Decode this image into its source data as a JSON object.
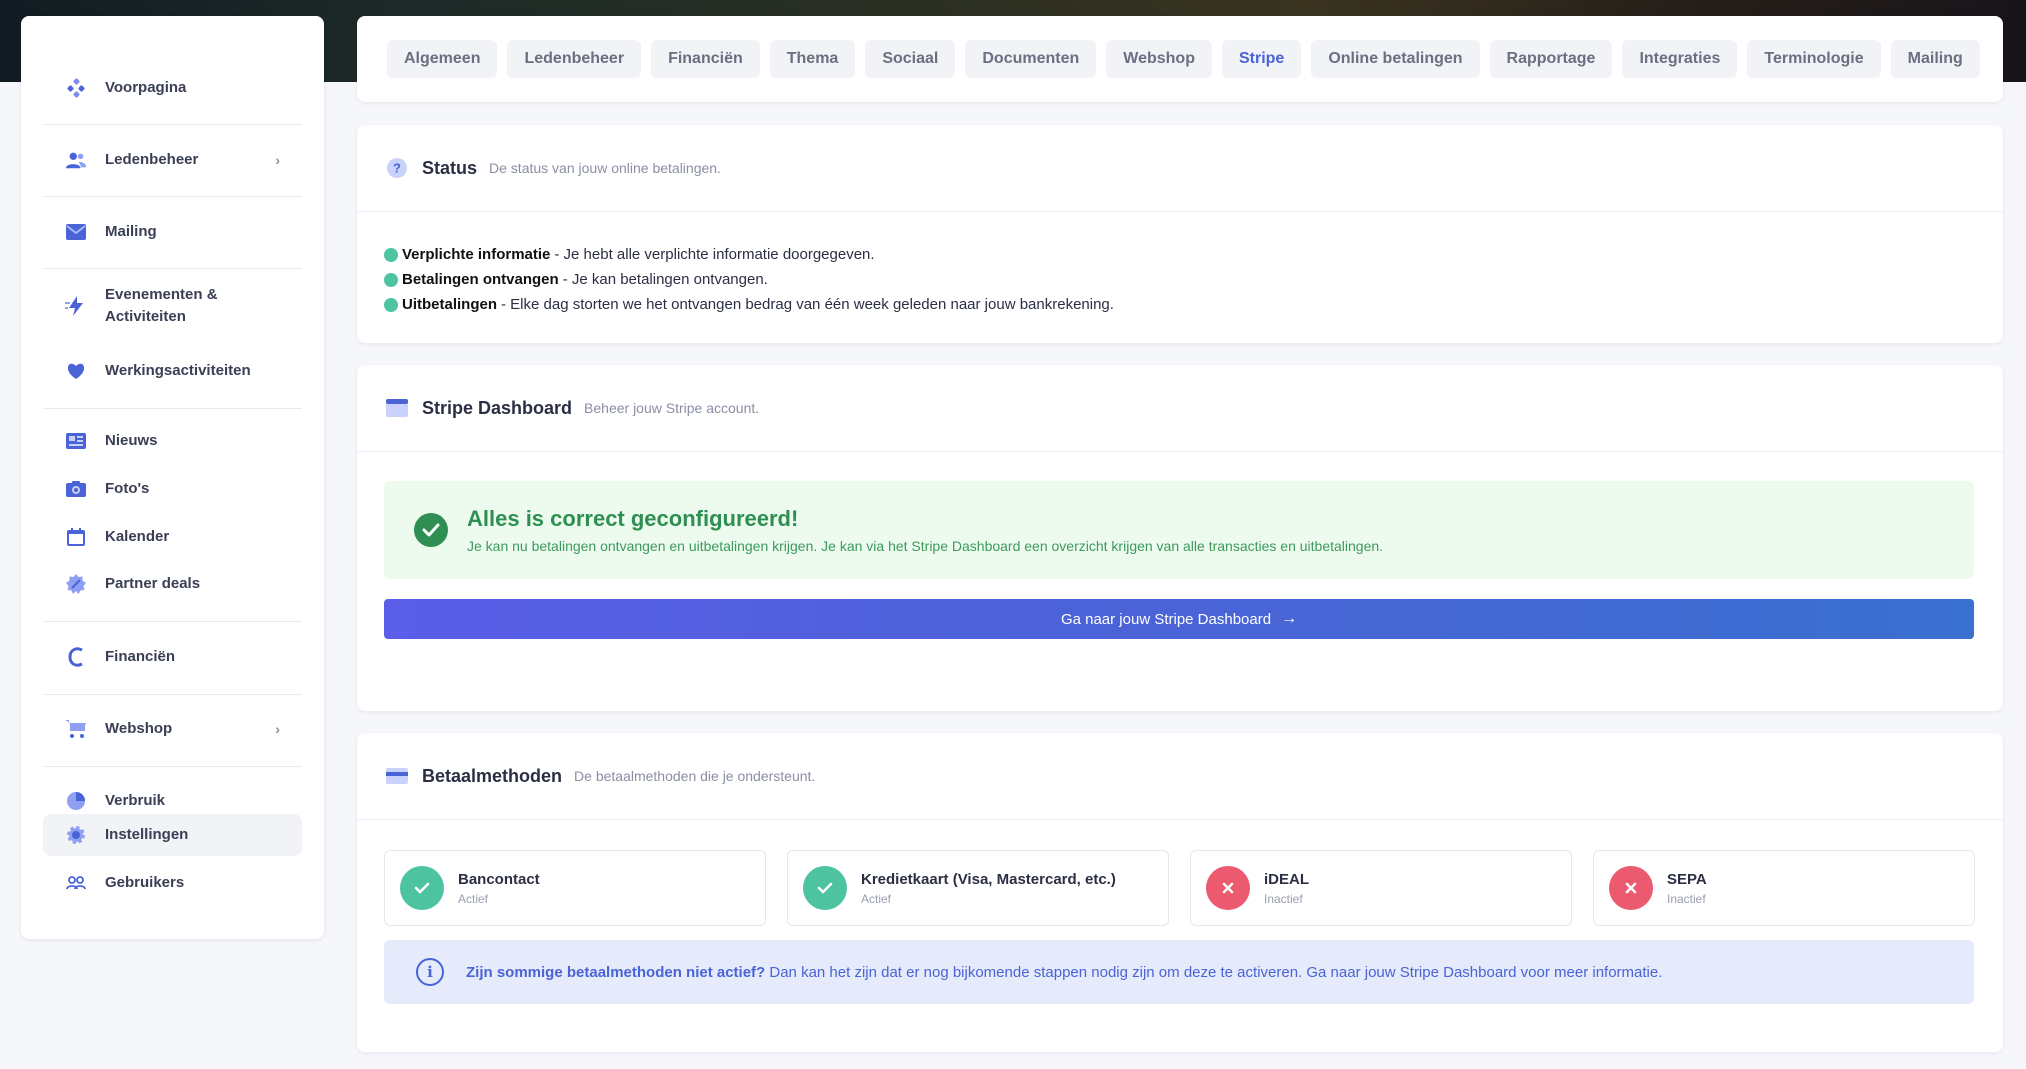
{
  "sidebar": {
    "items": [
      {
        "label": "Voorpagina",
        "icon": "home-icon"
      },
      {
        "label": "Ledenbeheer",
        "icon": "users-icon",
        "chevron": "›"
      },
      {
        "label": "Mailing",
        "icon": "mail-icon"
      },
      {
        "label": "Evenementen & Activiteiten",
        "icon": "lightning-icon"
      },
      {
        "label": "Werkingsactiviteiten",
        "icon": "heart-icon"
      },
      {
        "label": "Nieuws",
        "icon": "newspaper-icon"
      },
      {
        "label": "Foto's",
        "icon": "camera-icon"
      },
      {
        "label": "Kalender",
        "icon": "calendar-icon"
      },
      {
        "label": "Partner deals",
        "icon": "badge-icon"
      },
      {
        "label": "Financiën",
        "icon": "euro-icon"
      },
      {
        "label": "Webshop",
        "icon": "cart-icon",
        "chevron": "›"
      },
      {
        "label": "Verbruik",
        "icon": "pie-icon"
      },
      {
        "label": "Instellingen",
        "icon": "gear-icon"
      },
      {
        "label": "Gebruikers",
        "icon": "group-icon"
      }
    ]
  },
  "tabs": [
    "Algemeen",
    "Ledenbeheer",
    "Financiën",
    "Thema",
    "Sociaal",
    "Documenten",
    "Webshop",
    "Stripe",
    "Online betalingen",
    "Rapportage",
    "Integraties",
    "Terminologie",
    "Mailing"
  ],
  "status": {
    "title": "Status",
    "subtitle": "De status van jouw online betalingen.",
    "rows": [
      {
        "label": "Verplichte informatie",
        "text": "- Je hebt alle verplichte informatie doorgegeven."
      },
      {
        "label": "Betalingen ontvangen",
        "text": "- Je kan betalingen ontvangen."
      },
      {
        "label": "Uitbetalingen",
        "text": "- Elke dag storten we het ontvangen bedrag van één week geleden naar jouw bankrekening."
      }
    ]
  },
  "dashboard": {
    "title": "Stripe Dashboard",
    "subtitle": "Beheer jouw Stripe account.",
    "success_title": "Alles is correct geconfigureerd!",
    "success_text": "Je kan nu betalingen ontvangen en uitbetalingen krijgen. Je kan via het Stripe Dashboard een overzicht krijgen van alle transacties en uitbetalingen.",
    "button_label": "Ga naar jouw Stripe Dashboard",
    "button_arrow": "→"
  },
  "methods": {
    "title": "Betaalmethoden",
    "subtitle": "De betaalmethoden die je ondersteunt.",
    "items": [
      {
        "name": "Bancontact",
        "state": "Actief"
      },
      {
        "name": "Kredietkaart (Visa, Mastercard, etc.)",
        "state": "Actief"
      },
      {
        "name": "iDEAL",
        "state": "Inactief"
      },
      {
        "name": "SEPA",
        "state": "Inactief"
      }
    ],
    "info_bold": "Zijn sommige betaalmethoden niet actief?",
    "info_text": " Dan kan het zijn dat er nog bijkomende stappen nodig zijn om deze te activeren. Ga naar jouw Stripe Dashboard voor meer informatie."
  },
  "colors": {
    "accent": "#4a63d6",
    "success": "#2f8f52",
    "active_green": "#4dc3a0",
    "inactive_red": "#ec5a6f"
  }
}
